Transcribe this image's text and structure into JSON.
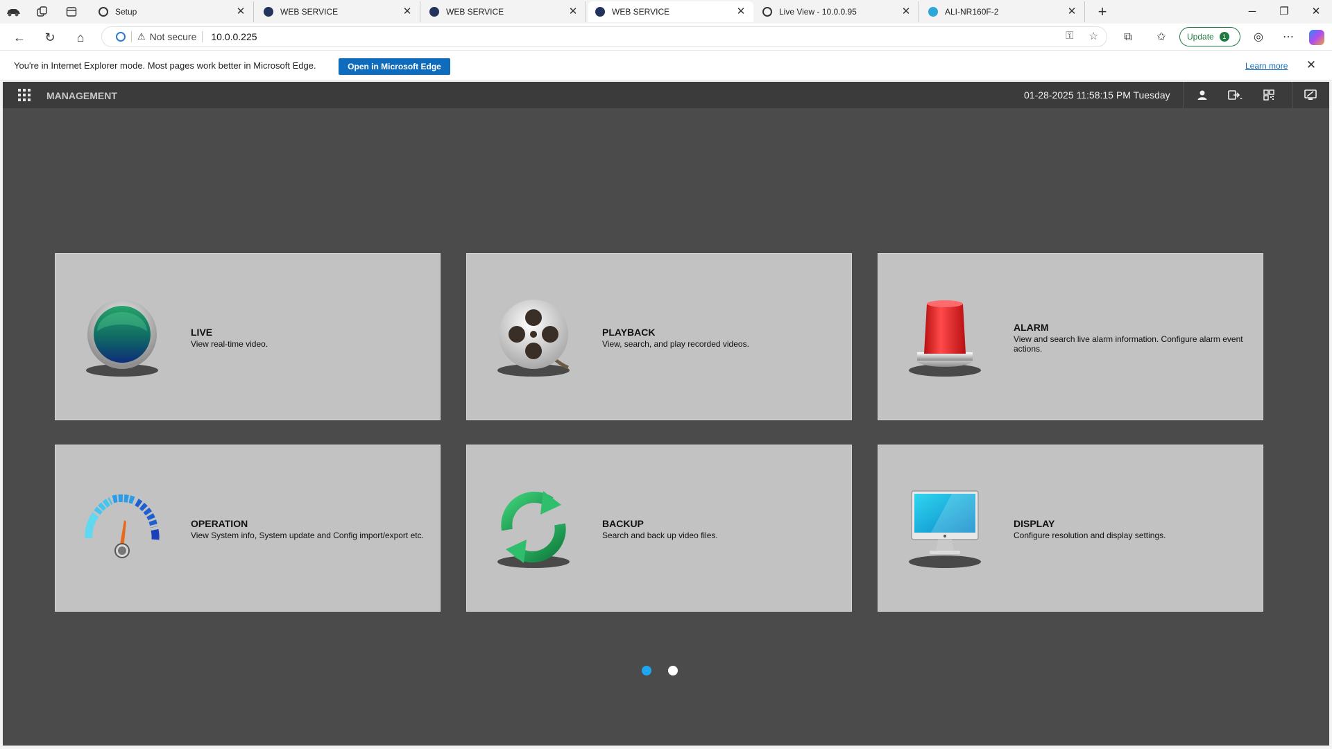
{
  "browser": {
    "tabs": [
      {
        "title": "Setup",
        "favicon_color": "#2b2b2b"
      },
      {
        "title": "WEB SERVICE",
        "favicon_color": "#24325e"
      },
      {
        "title": "WEB SERVICE",
        "favicon_color": "#24325e"
      },
      {
        "title": "WEB SERVICE",
        "favicon_color": "#24325e",
        "active": true
      },
      {
        "title": "Live View - 10.0.0.95",
        "favicon_color": "#2b2b2b"
      },
      {
        "title": "ALI-NR160F-2",
        "favicon_color": "#2ea6d8"
      }
    ],
    "address": {
      "security_text": "Not secure",
      "url": "10.0.0.225"
    },
    "update_label": "Update",
    "update_badge": "1",
    "infobar": {
      "message": "You're in Internet Explorer mode. Most pages work better in Microsoft Edge.",
      "button": "Open in Microsoft Edge",
      "link": "Learn more"
    }
  },
  "app": {
    "title": "MANAGEMENT",
    "datetime": "01-28-2025 11:58:15 PM Tuesday",
    "header_icons": [
      "user-icon",
      "logout-icon",
      "qr-code-icon",
      "monitor-icon"
    ],
    "cards": [
      {
        "title": "LIVE",
        "description": "View real-time video.",
        "icon": "live-orb-icon"
      },
      {
        "title": "PLAYBACK",
        "description": "View, search, and play recorded videos.",
        "icon": "film-reel-icon"
      },
      {
        "title": "ALARM",
        "description": "View and search live alarm information. Configure alarm event actions.",
        "icon": "alarm-siren-icon"
      },
      {
        "title": "OPERATION",
        "description": "View System info, System update and Config import/export etc.",
        "icon": "gauge-icon"
      },
      {
        "title": "BACKUP",
        "description": "Search and back up video files.",
        "icon": "sync-arrows-icon"
      },
      {
        "title": "DISPLAY",
        "description": "Configure resolution and display settings.",
        "icon": "display-monitor-icon"
      }
    ],
    "pager": {
      "current_page": 1,
      "total_pages": 2
    },
    "colors": {
      "accent": "#1ea6ef",
      "card_bg": "#c2c2c2",
      "app_bg": "#4b4b4b",
      "header_bg": "#3b3b3b"
    }
  }
}
